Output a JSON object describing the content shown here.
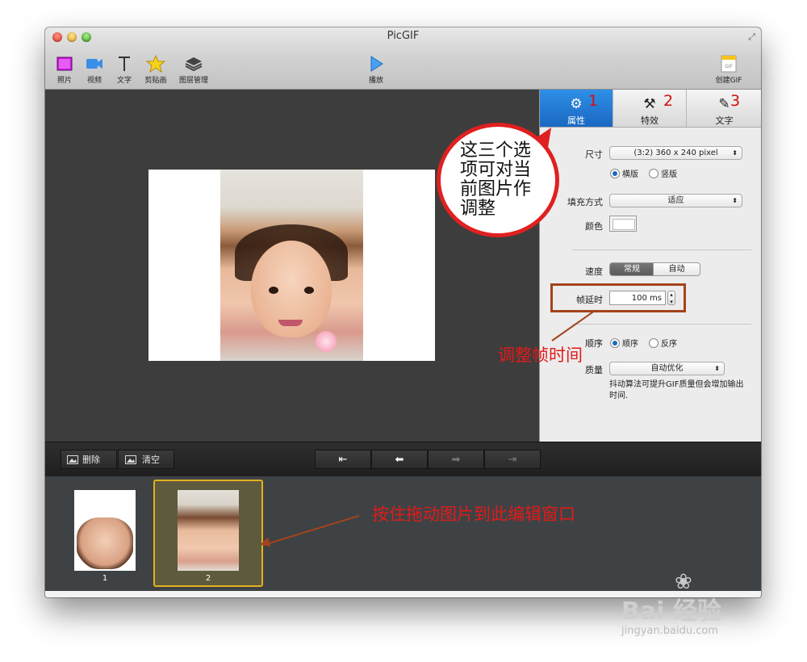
{
  "window": {
    "title": "PicGIF"
  },
  "toolbar": {
    "items": [
      {
        "label": "照片",
        "icon": "photo-icon"
      },
      {
        "label": "视频",
        "icon": "video-icon"
      },
      {
        "label": "文字",
        "icon": "text-icon"
      },
      {
        "label": "剪贴画",
        "icon": "star-icon"
      },
      {
        "label": "图层管理",
        "icon": "layers-icon"
      },
      {
        "label": "播放",
        "icon": "play-icon"
      },
      {
        "label": "创建GIF",
        "icon": "create-gif-icon"
      }
    ],
    "create_gif_icon_text": "GIF"
  },
  "inspector": {
    "tabs": [
      {
        "label": "属性",
        "icon": "gear-icon",
        "active": true
      },
      {
        "label": "特效",
        "icon": "magic-wand-icon",
        "active": false
      },
      {
        "label": "文字",
        "icon": "edit-icon",
        "active": false
      }
    ],
    "tab_numbers": [
      "1",
      "2",
      "3"
    ],
    "size_label": "尺寸",
    "size_value": "(3:2) 360 x 240 pixel",
    "orientation": {
      "landscape": "横版",
      "portrait": "竖版",
      "selected": "横版"
    },
    "fill_label": "填充方式",
    "fill_value": "适应",
    "color_label": "颜色",
    "color_value": "#ffffff",
    "speed_label": "速度",
    "speed_options": [
      "常规",
      "自动"
    ],
    "speed_selected": "常规",
    "delay_label": "帧延时",
    "delay_value": "100 ms",
    "order_label": "顺序",
    "order": {
      "forward": "顺序",
      "reverse": "反序",
      "selected": "顺序"
    },
    "quality_label": "质量",
    "quality_value": "自动优化",
    "quality_note": "抖动算法可提升GIF质量但会增加输出时间."
  },
  "annotations": {
    "bubble_text": "这三个选项可对当前图片作调整",
    "delay_note": "调整帧时间",
    "drag_note": "按住拖动图片到此编辑窗口"
  },
  "controls": {
    "delete_label": "删除",
    "clear_label": "清空"
  },
  "filmstrip": {
    "frames": [
      {
        "label": "1",
        "selected": false
      },
      {
        "label": "2",
        "selected": true
      }
    ]
  },
  "watermark": {
    "logo": "Bai 经验",
    "url": "jingyan.baidu.com"
  },
  "colors": {
    "accent": "#1a68c2",
    "annotation_red": "#e21a1a",
    "annotation_brown": "#a3431c",
    "selection_yellow": "#e3b11e"
  }
}
